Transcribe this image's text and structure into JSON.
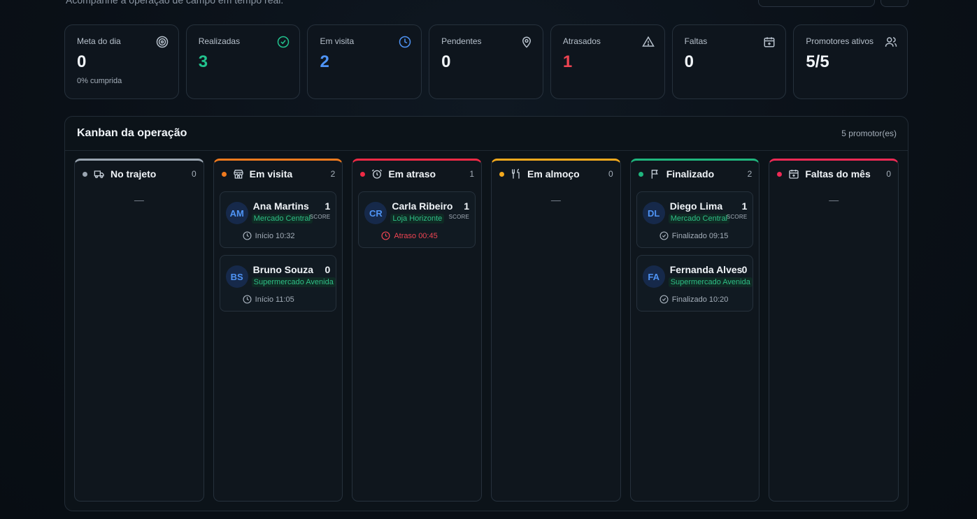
{
  "header": {
    "subtitle": "Acompanhe a operação de campo em tempo real."
  },
  "stats": [
    {
      "label": "Meta do dia",
      "value": "0",
      "sub": "0% cumprida",
      "icon": "target-icon",
      "color": "#f0f4f8"
    },
    {
      "label": "Realizadas",
      "value": "3",
      "icon": "check-circle-icon",
      "color": "#22c38e"
    },
    {
      "label": "Em visita",
      "value": "2",
      "icon": "clock-icon",
      "color": "#4f94f5"
    },
    {
      "label": "Pendentes",
      "value": "0",
      "icon": "map-pin-icon",
      "color": "#f0f4f8"
    },
    {
      "label": "Atrasados",
      "value": "1",
      "icon": "alert-triangle-icon",
      "color": "#ef4452"
    },
    {
      "label": "Faltas",
      "value": "0",
      "icon": "calendar-plus-icon",
      "color": "#f0f4f8"
    },
    {
      "label": "Promotores ativos",
      "value": "5/5",
      "icon": "users-icon",
      "color": "#f0f4f8"
    }
  ],
  "kanban": {
    "title": "Kanban da operação",
    "count": "5 promotor(es)",
    "columns": [
      {
        "title": "No trajeto",
        "count": "0",
        "color": "#9aa5b1",
        "icon": "truck-icon",
        "empty": "—"
      },
      {
        "title": "Em visita",
        "count": "2",
        "color": "#f07a1e",
        "icon": "store-icon",
        "cards": [
          {
            "initials": "AM",
            "name": "Ana Martins",
            "store": "Mercado Central",
            "score": "1",
            "score_label": "SCORE",
            "time": "Início 10:32"
          },
          {
            "initials": "BS",
            "name": "Bruno Souza",
            "store": "Supermercado Avenida",
            "score": "0",
            "time": "Início 11:05"
          }
        ]
      },
      {
        "title": "Em atraso",
        "count": "1",
        "color": "#ef2a45",
        "icon": "alarm-icon",
        "cards": [
          {
            "initials": "CR",
            "name": "Carla Ribeiro",
            "store": "Loja Horizonte",
            "score": "1",
            "score_label": "SCORE",
            "time": "Atraso 00:45"
          }
        ]
      },
      {
        "title": "Em almoço",
        "count": "0",
        "color": "#f4a91d",
        "icon": "utensils-icon",
        "empty": "—"
      },
      {
        "title": "Finalizado",
        "count": "2",
        "color": "#1fb67e",
        "icon": "flag-icon",
        "cards": [
          {
            "initials": "DL",
            "name": "Diego Lima",
            "store": "Mercado Central",
            "score": "1",
            "score_label": "SCORE",
            "time": "Finalizado 09:15"
          },
          {
            "initials": "FA",
            "name": "Fernanda Alves",
            "store": "Supermercado Avenida",
            "score": "0",
            "time": "Finalizado 10:20"
          }
        ]
      },
      {
        "title": "Faltas do mês",
        "count": "0",
        "color": "#ef2a55",
        "icon": "calendar-plus-icon",
        "empty": "—"
      }
    ]
  }
}
